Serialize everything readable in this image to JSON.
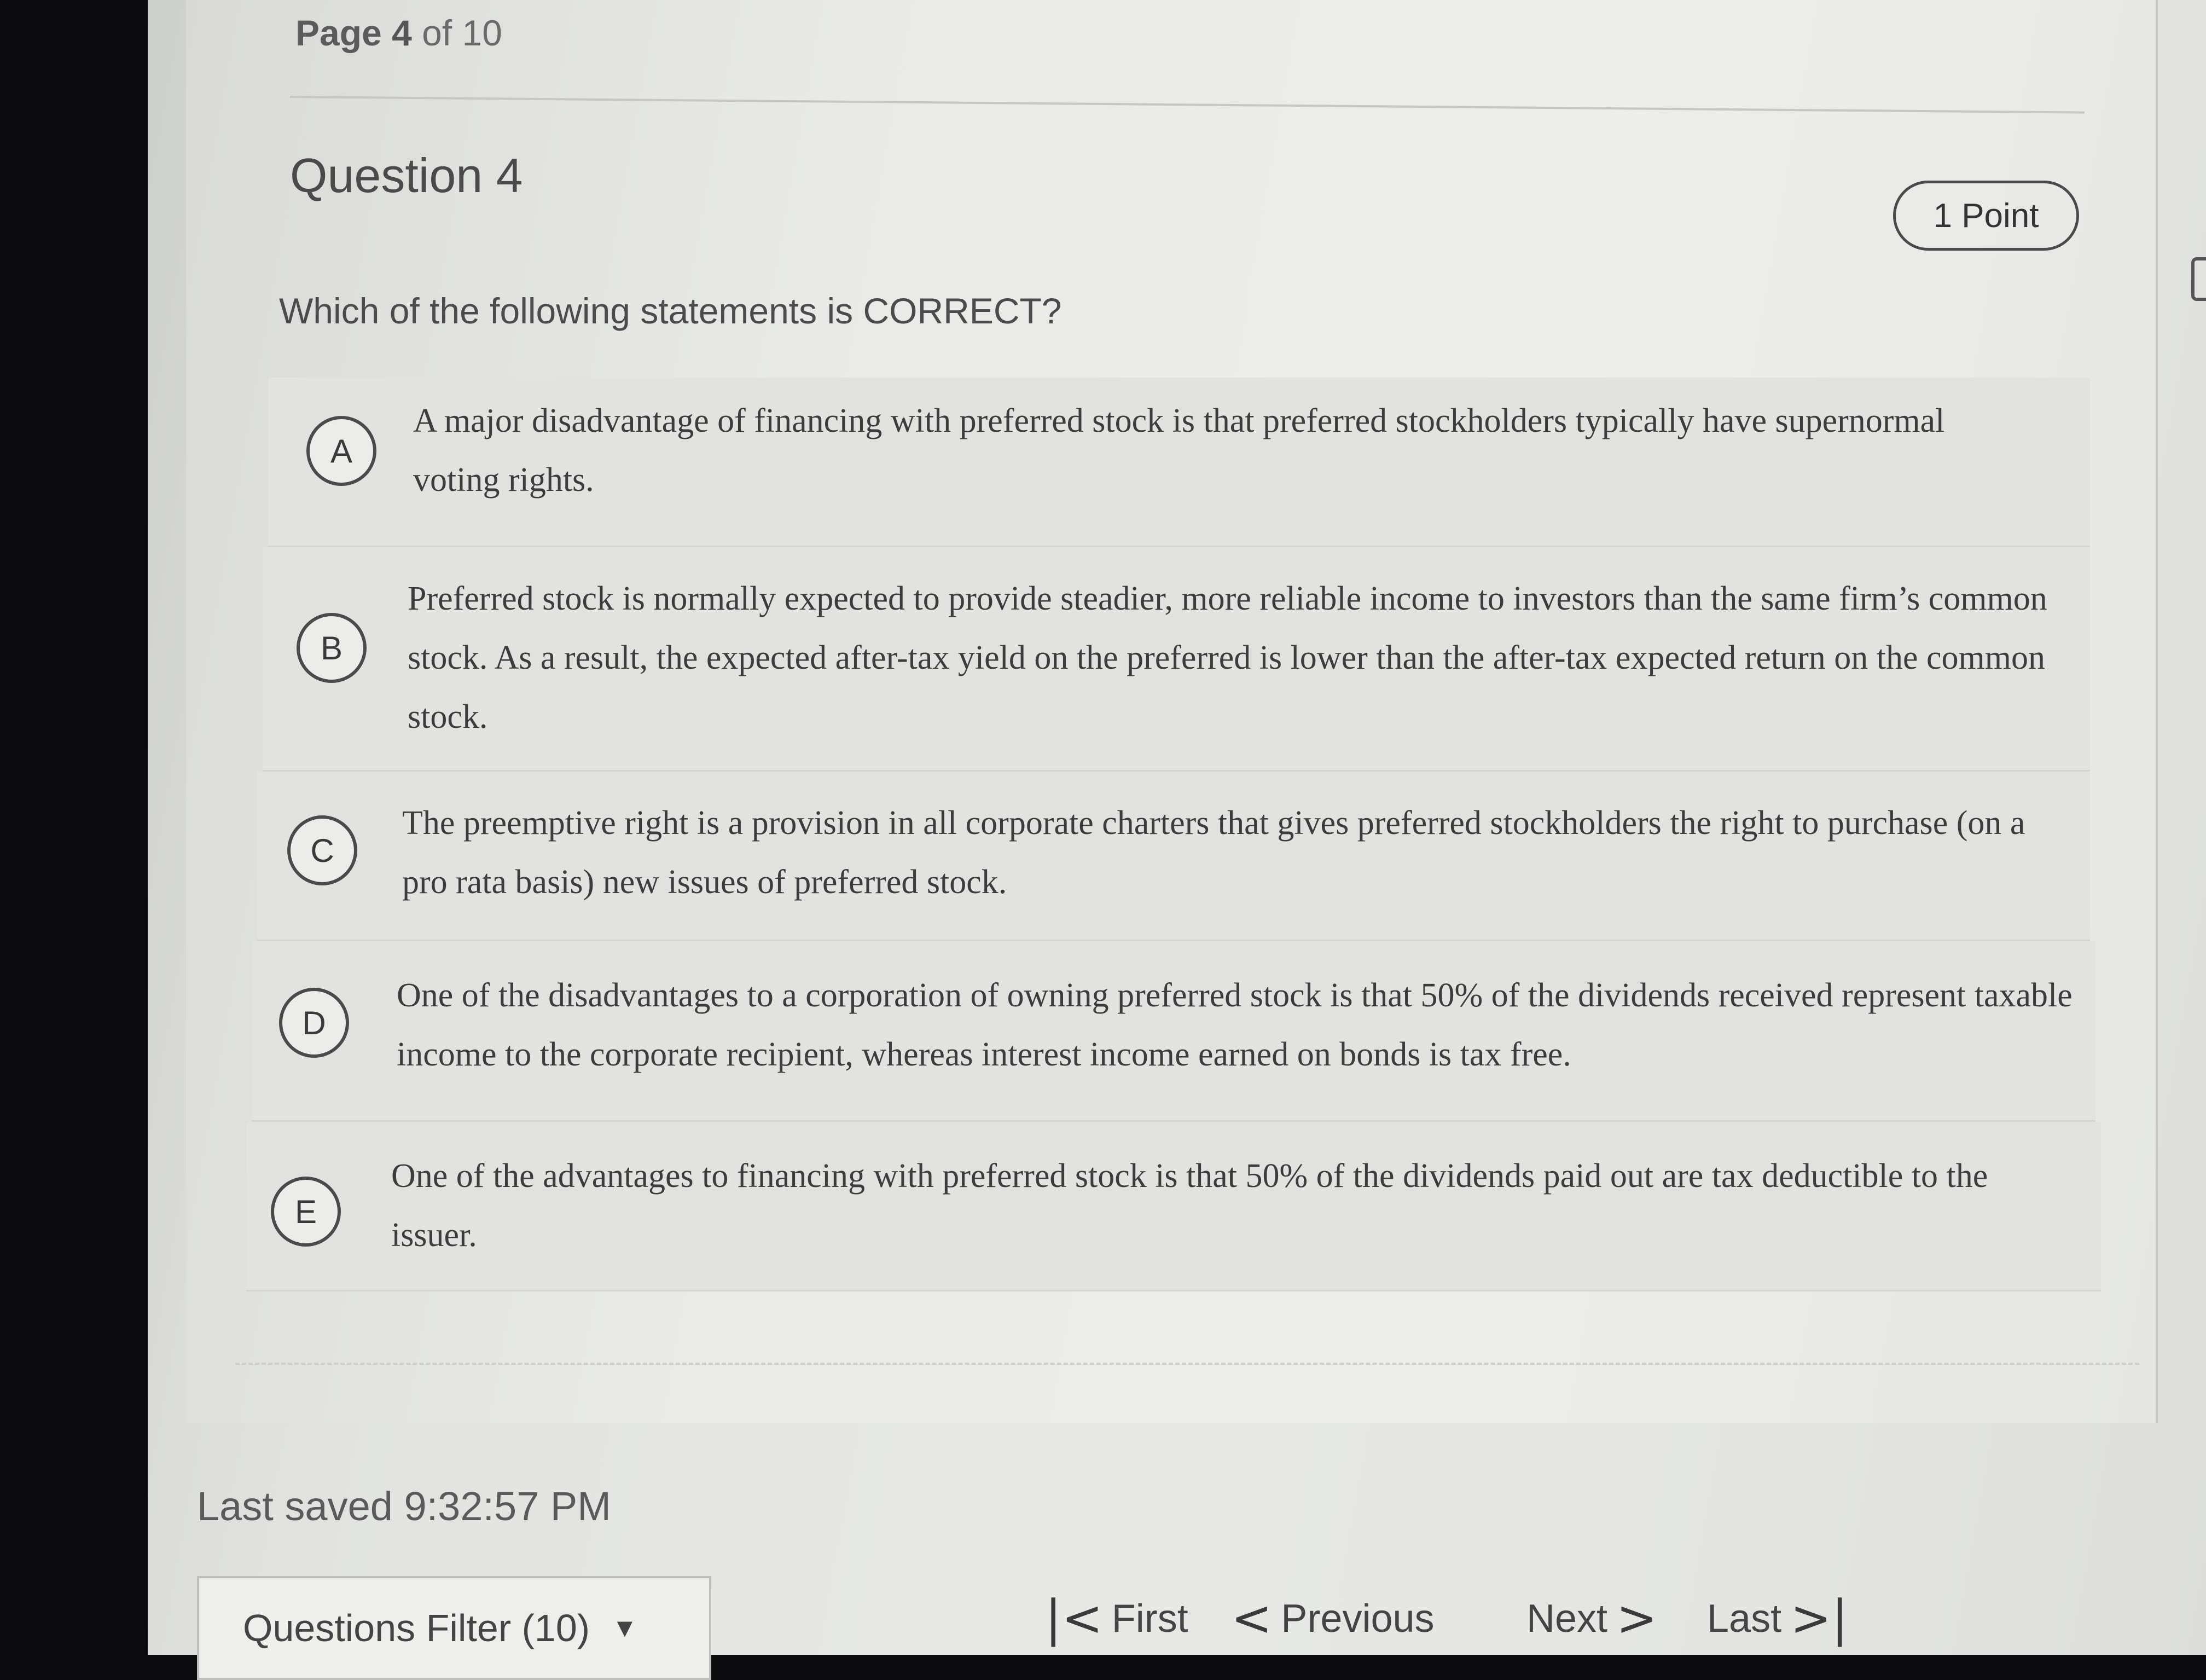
{
  "pagination": {
    "page_label": "Page",
    "current_page": "4",
    "of_label": "of",
    "total_pages": "10"
  },
  "question": {
    "title": "Question 4",
    "points": "1 Point",
    "prompt": "Which of the following statements is CORRECT?",
    "options": [
      {
        "letter": "A",
        "text": "A major disadvantage of financing with preferred stock is that preferred stockholders typically have supernormal voting rights."
      },
      {
        "letter": "B",
        "text": "Preferred stock is normally expected to provide steadier, more reliable income to investors than the same firm’s common stock. As a result, the expected after-tax yield on the preferred is lower than the after-tax expected return on the common stock."
      },
      {
        "letter": "C",
        "text": "The preemptive right is a provision in all corporate charters that gives preferred stockholders the right to purchase (on a pro rata basis) new issues of preferred stock."
      },
      {
        "letter": "D",
        "text": "One of the disadvantages to a corporation of owning preferred stock is that 50% of the dividends received represent taxable income to the corporate recipient, whereas interest income earned on bonds is tax free."
      },
      {
        "letter": "E",
        "text": "One of the advantages to financing with preferred stock is that 50% of the dividends paid out are tax deductible to the issuer."
      }
    ]
  },
  "footer": {
    "last_saved": "Last saved 9:32:57 PM",
    "filter_label": "Questions Filter (10)",
    "filter_caret": "▼",
    "nav": {
      "first": "First",
      "previous": "Previous",
      "next": "Next",
      "last": "Last"
    }
  },
  "icons": {
    "first": "first-page-icon",
    "previous": "chevron-left-icon",
    "next": "chevron-right-icon",
    "last": "last-page-icon"
  }
}
